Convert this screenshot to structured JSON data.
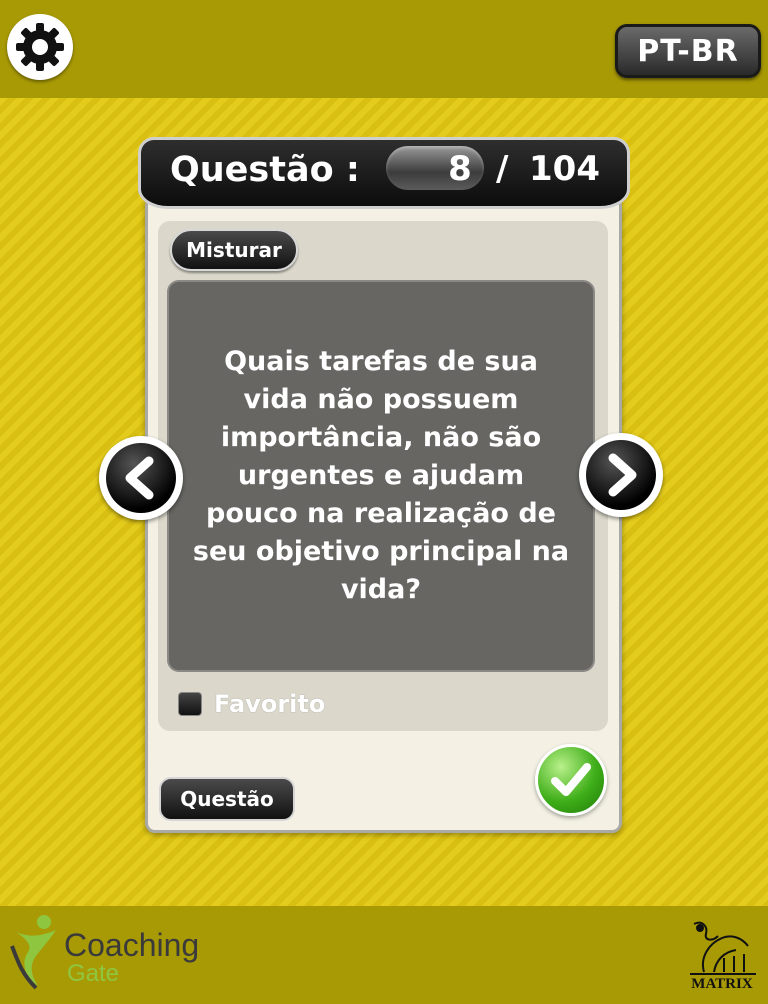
{
  "header": {
    "settings_icon": "gear-icon",
    "language_label": "PT-BR"
  },
  "card": {
    "title_label": "Questão :",
    "counter": {
      "current": "8",
      "separator": "/",
      "total": "104"
    },
    "shuffle_label": "Misturar",
    "question_text": "Quais tarefas de sua vida não possuem importância, não são urgentes e ajudam pouco na realização de seu objetivo principal na vida?",
    "favorite_label": "Favorito",
    "favorite_checked": false,
    "question_button_label": "Questão",
    "prev_icon": "chevron-left-icon",
    "next_icon": "chevron-right-icon",
    "confirm_icon": "checkmark-icon"
  },
  "footer": {
    "coaching_title": "Coaching",
    "coaching_subtitle": "Gate",
    "matrix_label": "MATRIX"
  },
  "colors": {
    "topbar": "#a89a05",
    "background": "#e2c81a",
    "question_box": "#676662",
    "confirm_green": "#3fae19",
    "coaching_green": "#8fc63f"
  }
}
